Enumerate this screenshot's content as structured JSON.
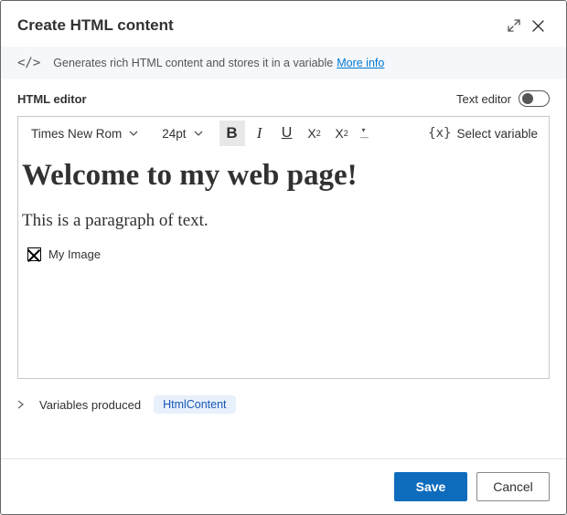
{
  "title": "Create HTML content",
  "infoText": "Generates rich HTML content and stores it in a variable",
  "moreInfoLabel": "More info",
  "editorLabel": "HTML editor",
  "textEditorLabel": "Text editor",
  "toolbar": {
    "fontFamily": "Times New Rom",
    "fontSize": "24pt",
    "selectVariable": "Select variable"
  },
  "content": {
    "heading": "Welcome to my web page!",
    "paragraph": "This is a paragraph of text.",
    "imageAlt": "My Image"
  },
  "variablesLabel": "Variables produced",
  "variableChip": "HtmlContent",
  "buttons": {
    "save": "Save",
    "cancel": "Cancel"
  }
}
